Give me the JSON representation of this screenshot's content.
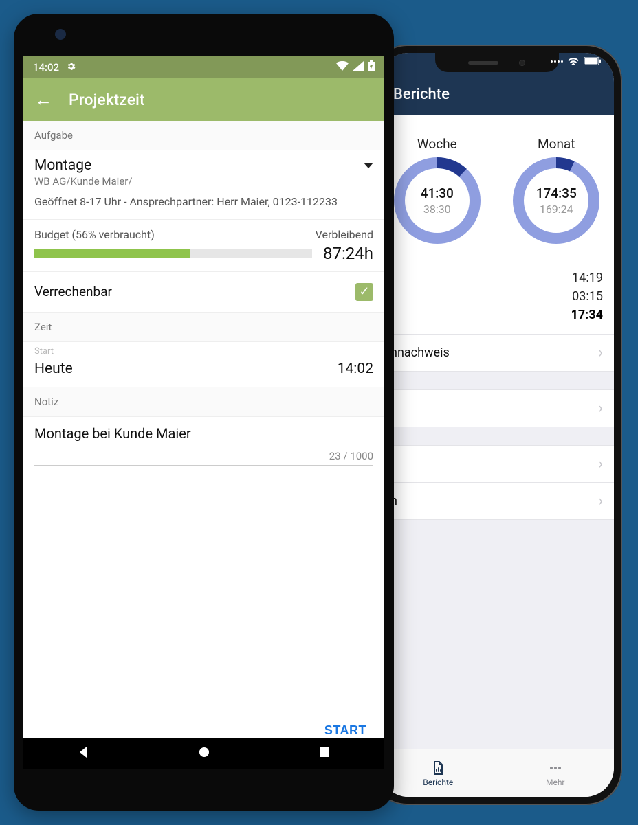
{
  "iphone": {
    "header_title": "Berichte",
    "donuts": {
      "week": {
        "label": "Woche",
        "big": "41:30",
        "small": "38:30",
        "percent": 12
      },
      "month": {
        "label": "Monat",
        "big": "174:35",
        "small": "169:24",
        "percent": 7
      }
    },
    "times": {
      "t1": "14:19",
      "t2": "03:15",
      "t3": "17:34"
    },
    "rows": {
      "r1": "nnachweis",
      "r2": "",
      "r3": "",
      "r4": "n"
    },
    "tabs": {
      "reports": "Berichte",
      "more": "Mehr"
    }
  },
  "android": {
    "status_time": "14:02",
    "appbar_title": "Projektzeit",
    "section_task": "Aufgabe",
    "task_name": "Montage",
    "task_path": "WB AG/Kunde Maier/",
    "task_desc": "Geöffnet 8-17 Uhr - Ansprechpartner: Herr Maier, 0123-112233",
    "budget_label": "Budget (56% verbraucht)",
    "budget_percent": 56,
    "remaining_label": "Verbleibend",
    "remaining_value": "87:24h",
    "billable_label": "Verrechenbar",
    "billable_checked": true,
    "section_time": "Zeit",
    "start_tiny": "Start",
    "start_day": "Heute",
    "start_time": "14:02",
    "section_note": "Notiz",
    "note_text": "Montage bei Kunde Maier",
    "note_counter": "23 / 1000",
    "start_button": "START"
  },
  "chart_data": [
    {
      "type": "pie",
      "title": "Woche",
      "categories": [
        "filled",
        "remaining"
      ],
      "values": [
        12,
        88
      ],
      "center_big": "41:30",
      "center_small": "38:30"
    },
    {
      "type": "pie",
      "title": "Monat",
      "categories": [
        "filled",
        "remaining"
      ],
      "values": [
        7,
        93
      ],
      "center_big": "174:35",
      "center_small": "169:24"
    },
    {
      "type": "bar",
      "title": "Budget",
      "categories": [
        "verbraucht",
        "verbleibend"
      ],
      "values": [
        56,
        44
      ],
      "ylim": [
        0,
        100
      ]
    }
  ]
}
